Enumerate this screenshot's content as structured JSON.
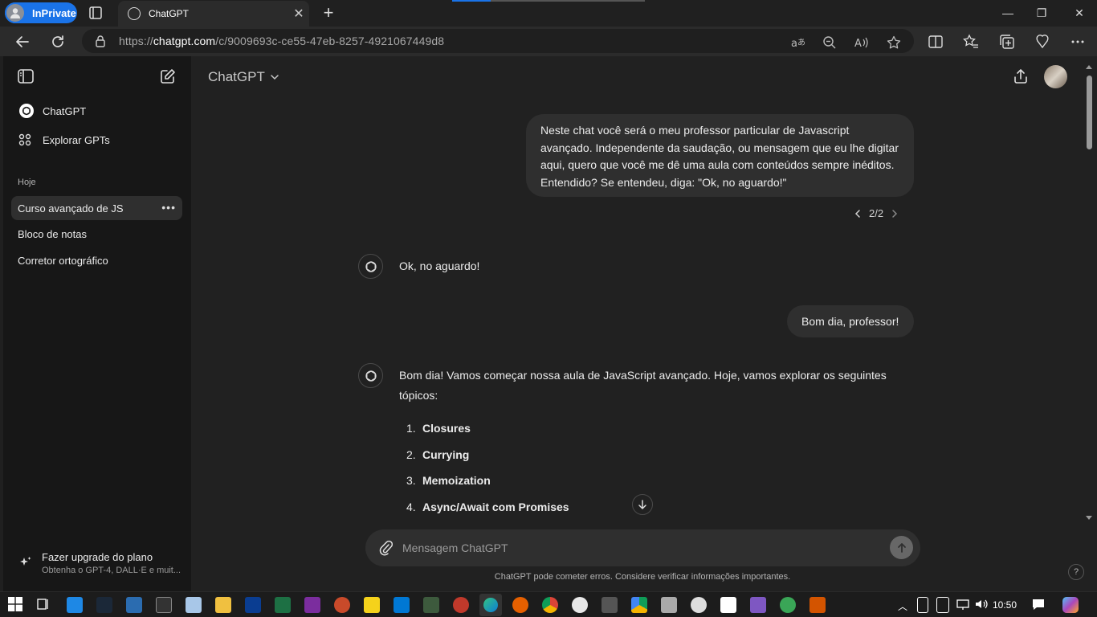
{
  "browser": {
    "inprivate_label": "InPrivate",
    "tab_title": "ChatGPT",
    "url_prefix": "https://",
    "url_domain": "chatgpt.com",
    "url_path": "/c/9009693c-ce55-47eb-8257-4921067449d8"
  },
  "sidebar": {
    "items": [
      {
        "label": "ChatGPT"
      },
      {
        "label": "Explorar GPTs"
      }
    ],
    "section_label": "Hoje",
    "history": [
      {
        "label": "Curso avançado de JS"
      },
      {
        "label": "Bloco de notas"
      },
      {
        "label": "Corretor ortográfico"
      }
    ],
    "upgrade_title": "Fazer upgrade do plano",
    "upgrade_subtitle": "Obtenha o GPT-4, DALL·E e muit..."
  },
  "main": {
    "title": "ChatGPT",
    "messages": {
      "user1": "Neste chat você será o meu professor particular de Javascript avançado. Independente da saudação, ou mensagem que eu lhe digitar aqui, quero que você me dê uma aula com conteúdos sempre inéditos. Entendido? Se entendeu, diga: \"Ok, no aguardo!\"",
      "pager": "2/2",
      "bot1": "Ok, no aguardo!",
      "user2": "Bom dia, professor!",
      "bot2": "Bom dia! Vamos começar nossa aula de JavaScript avançado. Hoje, vamos explorar os seguintes tópicos:",
      "topics": [
        {
          "num": "1.",
          "label": "Closures"
        },
        {
          "num": "2.",
          "label": "Currying"
        },
        {
          "num": "3.",
          "label": "Memoization"
        },
        {
          "num": "4.",
          "label": "Async/Await com Promises"
        }
      ]
    },
    "composer_placeholder": "Mensagem ChatGPT",
    "disclaimer": "ChatGPT pode cometer erros. Considere verificar informações importantes.",
    "help": "?"
  },
  "taskbar": {
    "clock": "10:50"
  },
  "colors": {
    "accent": "#1a73e8",
    "sidebar_bg": "#171717",
    "main_bg": "#212121",
    "bubble_bg": "#2f2f2f"
  }
}
